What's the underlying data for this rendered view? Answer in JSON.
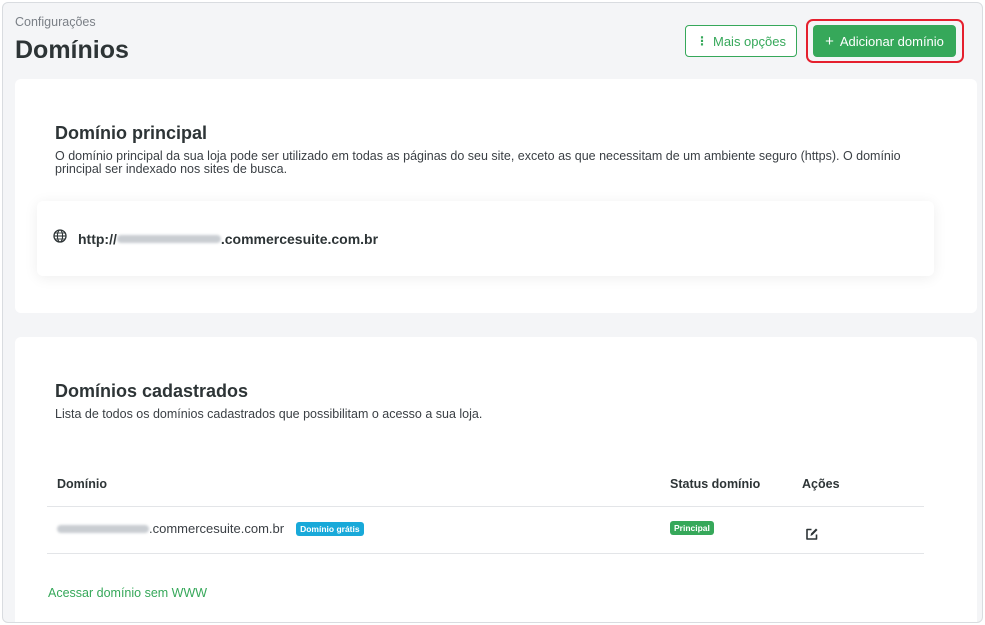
{
  "header": {
    "breadcrumb": "Configurações",
    "title": "Domínios",
    "more_options_label": "Mais opções",
    "add_domain_label": "Adicionar domínio"
  },
  "principal": {
    "title": "Domínio principal",
    "description": "O domínio principal da sua loja pode ser utilizado em todas as páginas do seu site, exceto as que necessitam de um ambiente seguro (https). O domínio principal ser indexado nos sites de busca.",
    "url_prefix": "http://",
    "url_suffix": ".commercesuite.com.br",
    "icon": "globe-icon"
  },
  "cadastrados": {
    "title": "Domínios cadastrados",
    "description": "Lista de todos os domínios cadastrados que possibilitam o acesso a sua loja.",
    "columns": [
      "Domínio",
      "Status domínio",
      "Ações"
    ],
    "rows": [
      {
        "domain_suffix": ".commercesuite.com.br",
        "domain_badge": "Domínio grátis",
        "status": "Principal",
        "action_icon": "edit-icon"
      }
    ],
    "link_www": "Acessar domínio sem WWW"
  },
  "colors": {
    "accent_green": "#36a85a",
    "badge_blue": "#19a9d9",
    "highlight_red": "#e5202e"
  }
}
